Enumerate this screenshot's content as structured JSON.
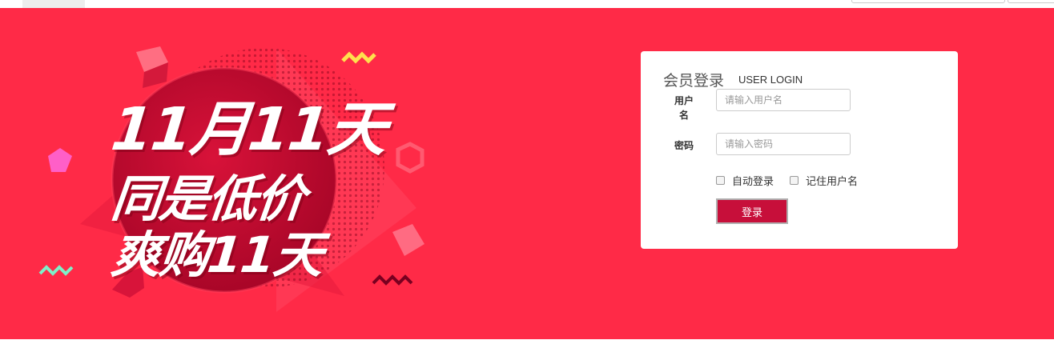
{
  "promo": {
    "line1": "11月11天",
    "line2": "同是低价",
    "line3": "爽购11天"
  },
  "login": {
    "title": "会员登录",
    "subtitle": "USER LOGIN",
    "username_label": "用户名",
    "username_placeholder": "请输入用户名",
    "password_label": "密码",
    "password_placeholder": "请输入密码",
    "auto_login_label": "自动登录",
    "remember_username_label": "记住用户名",
    "submit_label": "登录"
  },
  "colors": {
    "banner_bg": "#ff2a47",
    "circle": "#b8092c",
    "button": "#c70f3a"
  }
}
